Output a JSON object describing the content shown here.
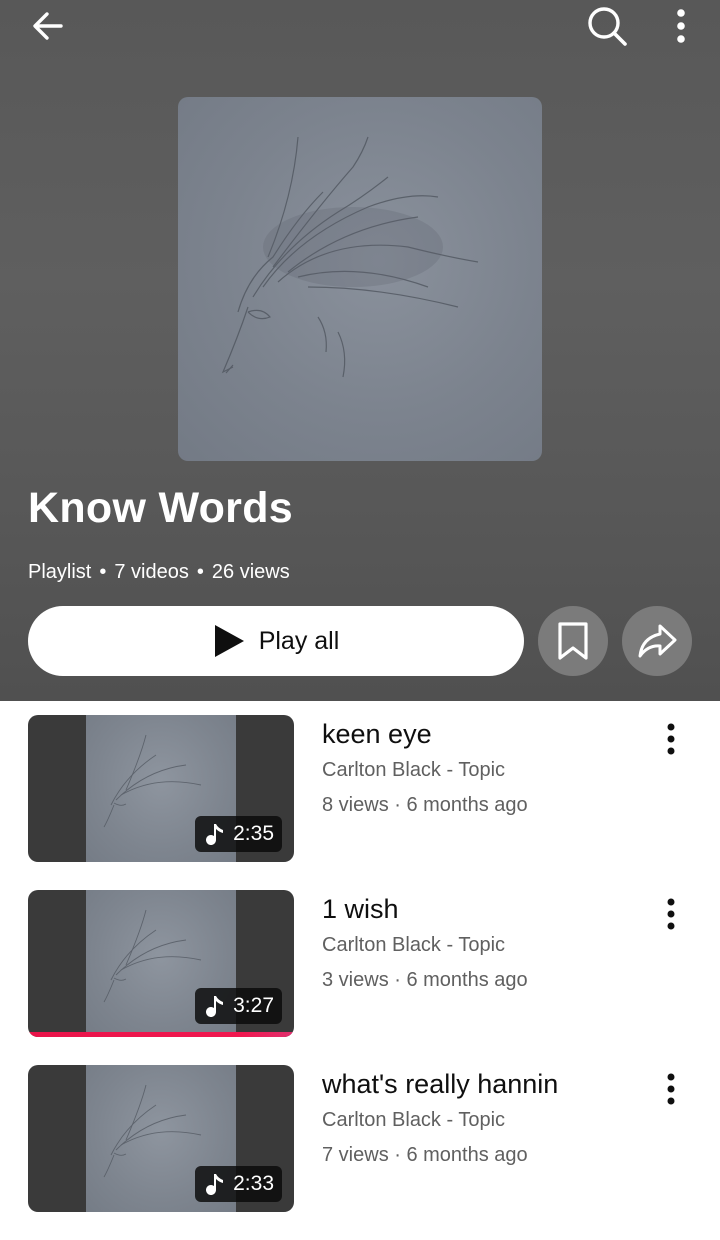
{
  "colors": {
    "header_background": "#5c5c5c",
    "accent_progress": "#f0184f",
    "primary_text": "#0f0f0f",
    "secondary_text": "#606060"
  },
  "top_bar": {
    "back_icon": "arrow-left-icon",
    "search_icon": "search-icon",
    "more_icon": "more-vert-icon"
  },
  "playlist": {
    "cover_icon": "pencil-sketch-portrait",
    "title": "Know Words",
    "type": "Playlist",
    "video_count": "7 videos",
    "views": "26 views",
    "separator": "•"
  },
  "actions": {
    "play_all_label": "Play all",
    "play_icon": "play-icon",
    "save_icon": "bookmark-icon",
    "share_icon": "share-arrow-icon"
  },
  "items": [
    {
      "title": "keen eye",
      "channel": "Carlton Black - Topic",
      "stats": "8 views · 6 months ago",
      "duration": "2:35",
      "progress": 0
    },
    {
      "title": "1 wish",
      "channel": "Carlton Black - Topic",
      "stats": "3 views · 6 months ago",
      "duration": "3:27",
      "progress": 1.0
    },
    {
      "title": "what's really hannin",
      "channel": "Carlton Black - Topic",
      "stats": "7 views · 6 months ago",
      "duration": "2:33",
      "progress": 0
    }
  ]
}
